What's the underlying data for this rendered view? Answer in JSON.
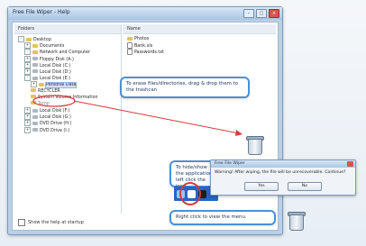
{
  "window": {
    "title": "Free File Wiper - Help",
    "folders_header": "Folders",
    "files_header": "Name",
    "show_icon_label": "Show the help at startup"
  },
  "tree": [
    {
      "label": "Desktop",
      "type": "folder",
      "expander": "-"
    },
    {
      "label": "Documents",
      "type": "folder",
      "expander": "+"
    },
    {
      "label": "Network and Computer",
      "type": "folder",
      "expander": "-"
    },
    {
      "label": "Floppy Disk (A:)",
      "type": "drive",
      "expander": "+"
    },
    {
      "label": "Local Disk (C:)",
      "type": "drive",
      "expander": "+"
    },
    {
      "label": "Local Disk (D:)",
      "type": "drive",
      "expander": "+"
    },
    {
      "label": "Local Disk (E:)",
      "type": "drive",
      "expander": "-"
    },
    {
      "label": "Personal Data",
      "type": "folder",
      "expander": "+",
      "selected": true
    },
    {
      "label": "RECYCLER",
      "type": "folder",
      "expander": ""
    },
    {
      "label": "System Volume Information",
      "type": "folder",
      "expander": ""
    },
    {
      "label": "Temp",
      "type": "folder",
      "expander": "",
      "faded": true
    },
    {
      "label": "Local Disk (F:)",
      "type": "drive",
      "expander": "+"
    },
    {
      "label": "Local Disk (G:)",
      "type": "drive",
      "expander": "+"
    },
    {
      "label": "DVD Drive (H:)",
      "type": "drive",
      "expander": "+"
    },
    {
      "label": "DVD Drive (I:)",
      "type": "drive",
      "expander": "+"
    }
  ],
  "files": [
    {
      "label": "Photos",
      "type": "folder"
    },
    {
      "label": "Bank.xls",
      "type": "doc"
    },
    {
      "label": "Passwords.txt",
      "type": "doc"
    }
  ],
  "callouts": {
    "drag_drop": "To erase files/directories, drag & drop them to the trashcan",
    "right_click": "Right click to view the menu.",
    "tray_hint": "To hide/show the application, left click the icon."
  },
  "dialog": {
    "title": "Free File Wiper",
    "message": "Warning! After wiping, the file will be unrecoverable. Continue?",
    "yes": "Yes",
    "no": "No"
  },
  "colors": {
    "accent": "#4a90d9",
    "highlight_red": "#d63b3b",
    "taskbar": "#2b64c6"
  }
}
